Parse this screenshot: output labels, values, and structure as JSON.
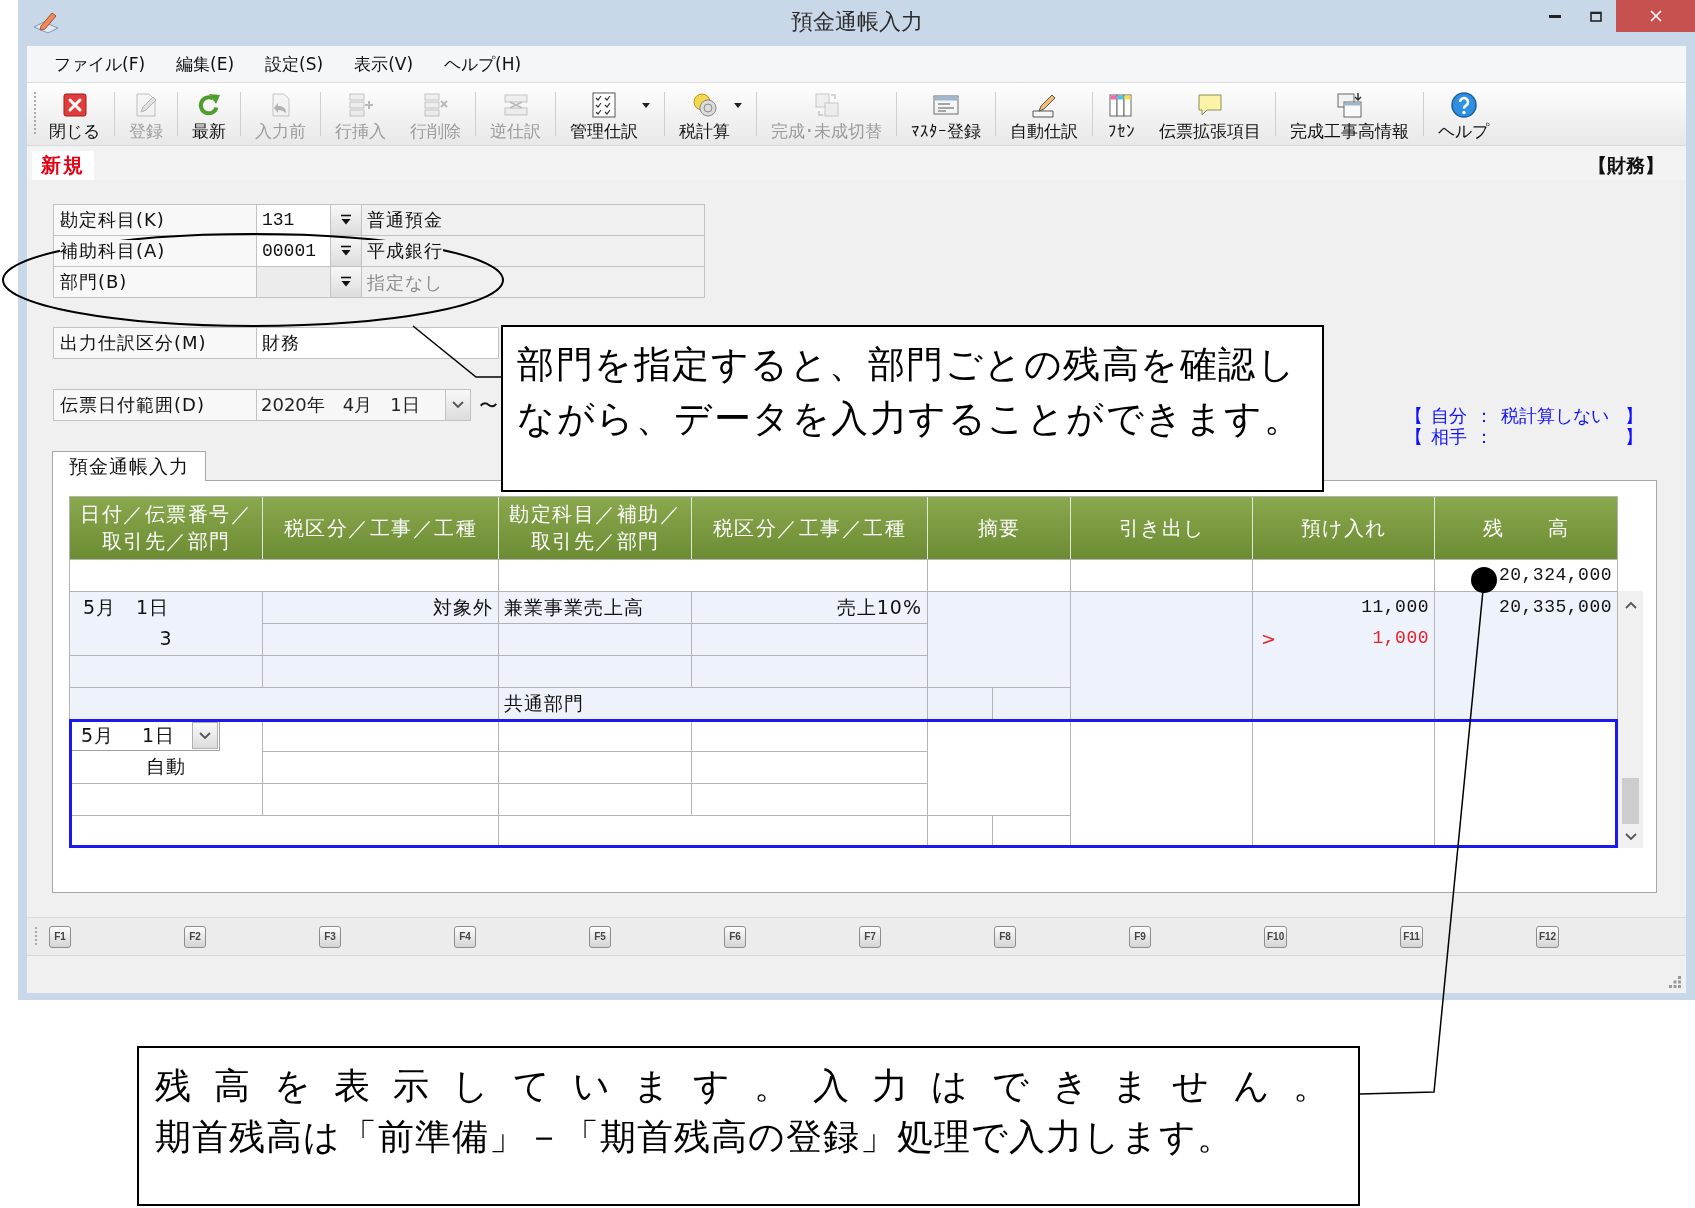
{
  "window": {
    "title": "預金通帳入力"
  },
  "menu": [
    {
      "label": "ファイル(F)"
    },
    {
      "label": "編集(E)"
    },
    {
      "label": "設定(S)"
    },
    {
      "label": "表示(V)"
    },
    {
      "label": "ヘルプ(H)"
    }
  ],
  "toolbar": {
    "groups": [
      [
        {
          "kind": "close",
          "label": "閉じる",
          "disabled": false,
          "dropdown": false
        }
      ],
      [
        {
          "kind": "save",
          "label": "登録",
          "disabled": true,
          "dropdown": false
        }
      ],
      [
        {
          "kind": "refresh",
          "label": "最新",
          "disabled": false,
          "dropdown": false
        }
      ],
      [
        {
          "kind": "undo",
          "label": "入力前",
          "disabled": true,
          "dropdown": false
        }
      ],
      [
        {
          "kind": "insert_row",
          "label": "行挿入",
          "disabled": true,
          "dropdown": false
        },
        {
          "kind": "delete_row",
          "label": "行削除",
          "disabled": true,
          "dropdown": false
        }
      ],
      [
        {
          "kind": "reverse",
          "label": "逆仕訳",
          "disabled": true,
          "dropdown": false
        }
      ],
      [
        {
          "kind": "manage",
          "label": "管理仕訳",
          "disabled": false,
          "dropdown": true
        }
      ],
      [
        {
          "kind": "tax",
          "label": "税計算",
          "disabled": false,
          "dropdown": true
        }
      ],
      [
        {
          "kind": "switch",
          "label": "完成･未成切替",
          "disabled": true,
          "dropdown": false
        }
      ],
      [
        {
          "kind": "master",
          "label": "ﾏｽﾀｰ登録",
          "disabled": false,
          "dropdown": false
        }
      ],
      [
        {
          "kind": "auto",
          "label": "自動仕訳",
          "disabled": false,
          "dropdown": false
        }
      ],
      [
        {
          "kind": "sticky",
          "label": "ﾌｾﾝ",
          "disabled": false,
          "dropdown": false
        },
        {
          "kind": "extension",
          "label": "伝票拡張項目",
          "disabled": false,
          "dropdown": false
        }
      ],
      [
        {
          "kind": "completion",
          "label": "完成工事高情報",
          "disabled": false,
          "dropdown": false
        }
      ],
      [
        {
          "kind": "help",
          "label": "ヘルプ",
          "disabled": false,
          "dropdown": false
        }
      ]
    ]
  },
  "mode": {
    "label": "新規",
    "category": "【財務】"
  },
  "form": {
    "lookups": [
      {
        "label": "勘定科目(K)",
        "code": "131",
        "name": "普通預金"
      },
      {
        "label": "補助科目(A)",
        "code": "00001",
        "name": "平成銀行"
      },
      {
        "label": "部門(B)",
        "placeholder": "指定なし"
      }
    ],
    "journal_type": {
      "label": "出力仕訳区分(M)",
      "value": "財務"
    },
    "date_range": {
      "label": "伝票日付範囲(D)",
      "from": "2020年　4月　1日",
      "separator": "〜"
    }
  },
  "tax_info": [
    {
      "open": "【",
      "party": "自分",
      "colon": "：",
      "value": "税計算しない",
      "close": "】"
    },
    {
      "open": "【",
      "party": "相手",
      "colon": "：",
      "close": "】"
    }
  ],
  "tabs": [
    {
      "label": "預金通帳入力",
      "selected": true
    }
  ],
  "table": {
    "columns": [
      "日付／伝票番号／取引先／部門",
      "税区分／工事／工種",
      "勘定科目／補助／取引先／部門",
      "税区分／工事／工種",
      "摘要",
      "引き出し",
      "預け入れ",
      "残　　高"
    ],
    "opening_balance": "20,324,000",
    "entries": [
      {
        "kind": "posted",
        "selected": false,
        "date": "5月　1日",
        "voucher": "3",
        "tax_category": "対象外",
        "account": "兼業事業売上高",
        "counter_tax": "売上10%",
        "department": "共通部門",
        "deposit": "11,000",
        "tax_marker": ">",
        "tax_amount": "1,000",
        "balance": "20,335,000"
      },
      {
        "kind": "new",
        "selected": true,
        "month": "5月",
        "day": "1日",
        "voucher": "自動"
      }
    ]
  },
  "function_keys": [
    "F1",
    "F2",
    "F3",
    "F4",
    "F5",
    "F6",
    "F7",
    "F8",
    "F9",
    "F10",
    "F11",
    "F12"
  ],
  "annotations": [
    {
      "kind": "ellipse_note",
      "text": "部門を指定すると、部門ごとの残高を確認しながら、データを入力することができます。"
    },
    {
      "kind": "dot_note",
      "lines": [
        "残高を表示しています。入力はできません。",
        "期首残高は「前準備」－「期首残高の登録」処理で入力します。"
      ]
    }
  ]
}
